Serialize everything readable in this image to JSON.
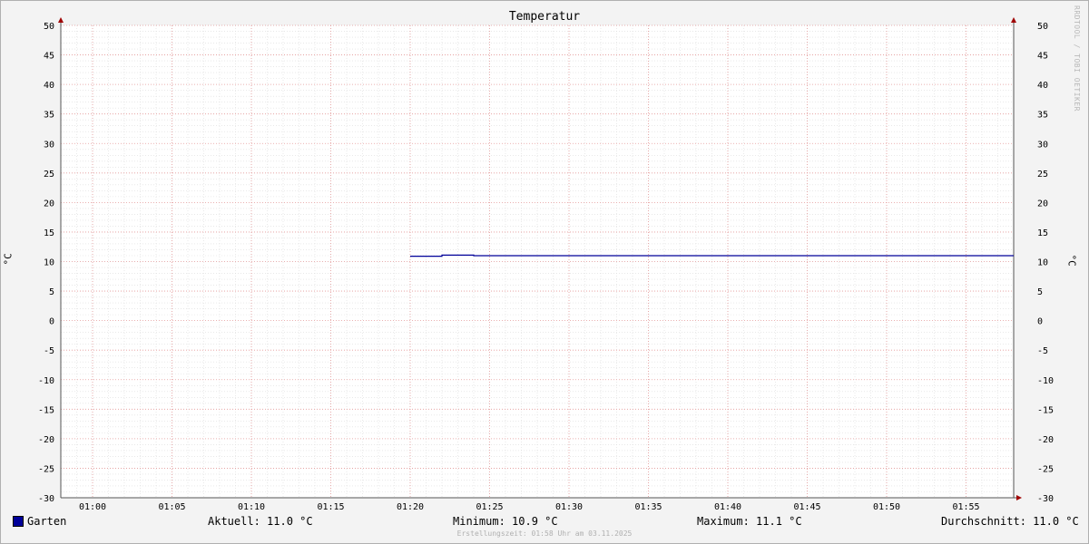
{
  "chart_data": {
    "type": "line",
    "title": "Temperatur",
    "ylabel": "°C",
    "ylim": [
      -30,
      50
    ],
    "yticks": [
      50,
      45,
      40,
      35,
      30,
      25,
      20,
      15,
      10,
      5,
      0,
      -5,
      -10,
      -15,
      -20,
      -25,
      -30
    ],
    "xlim": [
      "00:58",
      "01:58"
    ],
    "xticks": [
      "01:00",
      "01:05",
      "01:10",
      "01:15",
      "01:20",
      "01:25",
      "01:30",
      "01:35",
      "01:40",
      "01:45",
      "01:50",
      "01:55"
    ],
    "grid": true,
    "series": [
      {
        "name": "Garten",
        "color": "#000099",
        "points": [
          {
            "x": "01:20",
            "y": 10.9
          },
          {
            "x": "01:22",
            "y": 10.9
          },
          {
            "x": "01:22",
            "y": 11.1
          },
          {
            "x": "01:24",
            "y": 11.1
          },
          {
            "x": "01:24",
            "y": 11.0
          },
          {
            "x": "01:58",
            "y": 11.0
          }
        ]
      }
    ],
    "legend_position": "bottom-left"
  },
  "stats": {
    "current": "Aktuell: 11.0 °C",
    "minimum": "Minimum: 10.9 °C",
    "maximum": "Maximum: 11.1 °C",
    "average": "Durchschnitt: 11.0 °C"
  },
  "footer": "Erstellungszeit: 01:58 Uhr am 03.11.2025",
  "watermark": "RRDTOOL / TOBI OETIKER"
}
